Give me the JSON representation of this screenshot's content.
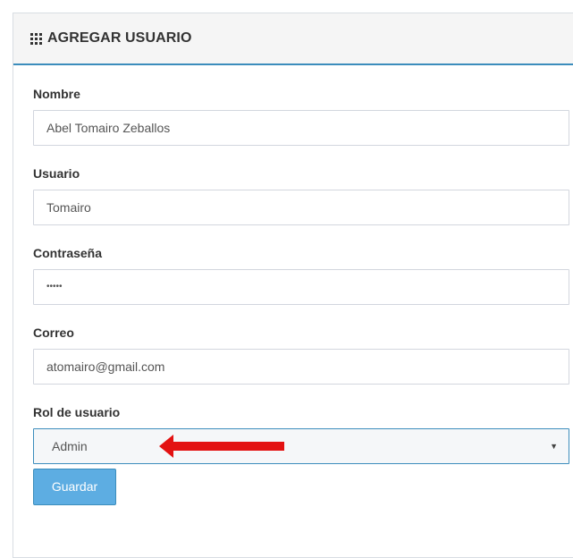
{
  "panel": {
    "title": "AGREGAR USUARIO",
    "icon": "th-grid-icon"
  },
  "form": {
    "nombre": {
      "label": "Nombre",
      "value": "Abel Tomairo Zeballos"
    },
    "usuario": {
      "label": "Usuario",
      "value": "Tomairo"
    },
    "contrasena": {
      "label": "Contraseña",
      "value": "•••••"
    },
    "correo": {
      "label": "Correo",
      "value": "atomairo@gmail.com"
    },
    "rol": {
      "label": "Rol de usuario",
      "value": "Admin",
      "caret": "▼"
    },
    "submit_label": "Guardar"
  },
  "colors": {
    "accent": "#3c8dbc",
    "button_bg": "#5dade2",
    "annotation_arrow": "#e31212"
  }
}
